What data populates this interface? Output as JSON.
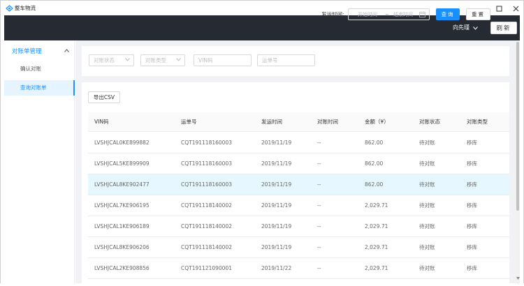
{
  "window": {
    "title": "整车物流"
  },
  "header": {
    "user_name": "向先瑾",
    "refresh_label": "刷新"
  },
  "sidebar": {
    "group_label": "对账单管理",
    "items": [
      {
        "label": "确认对账"
      },
      {
        "label": "查询对账单",
        "active": true
      }
    ]
  },
  "filters": {
    "status_placeholder": "对账状态",
    "type_placeholder": "对账类型",
    "vin_placeholder": "VIN码",
    "waybill_placeholder": "运单号",
    "ship_time_label": "发运时间:",
    "start_placeholder": "开始时间",
    "range_separator": "~",
    "end_placeholder": "结束时间",
    "query_label": "查询",
    "reset_label": "重置"
  },
  "table": {
    "export_label": "导出CSV",
    "columns": [
      "VIN码",
      "运单号",
      "发运时间",
      "对账时间",
      "金额（¥）",
      "对账状态",
      "对账类型"
    ],
    "rows": [
      [
        "LVSHJCAL0KE899882",
        "CQT191118160003",
        "2019/11/19",
        "--",
        "862.00",
        "待对账",
        "移库"
      ],
      [
        "LVSHJCAL5KE899909",
        "CQT191118160003",
        "2019/11/19",
        "--",
        "862.00",
        "待对账",
        "移库"
      ],
      [
        "LVSHJCAL8KE902477",
        "CQT191118160003",
        "2019/11/19",
        "--",
        "862.00",
        "待对账",
        "移库"
      ],
      [
        "LVSHJCAL7KE906195",
        "CQT191118140002",
        "2019/11/19",
        "--",
        "2,029.71",
        "待对账",
        "移库"
      ],
      [
        "LVSHJCAL1KE906189",
        "CQT191118140002",
        "2019/11/19",
        "--",
        "2,029.71",
        "待对账",
        "移库"
      ],
      [
        "LVSHJCAL8KE906206",
        "CQT191118140002",
        "2019/11/19",
        "--",
        "2,029.71",
        "待对账",
        "移库"
      ],
      [
        "LVSHJCAL2KE908856",
        "CQT191121090001",
        "2019/11/22",
        "--",
        "2,029.71",
        "待对账",
        "移库"
      ]
    ],
    "highlighted_row": 2
  },
  "colors": {
    "header_bg": "#262a33",
    "accent": "#1890ff",
    "row_highlight": "#e6f7ff",
    "content_bg": "#f0f2f5"
  },
  "icons": [
    "app-logo-icon",
    "minimize-icon",
    "maximize-icon",
    "close-icon",
    "chevron-down-icon",
    "chevron-up-icon",
    "calendar-icon",
    "scroll-down-arrow-icon"
  ]
}
